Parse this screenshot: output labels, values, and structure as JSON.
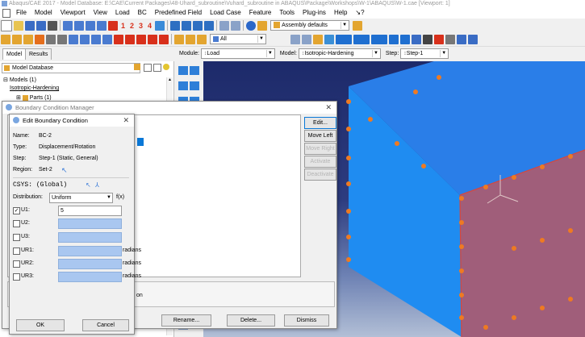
{
  "window": {
    "title": "Abaqus/CAE 2017 - Model Database: E:\\CAE\\Current Packages\\48-Uhard_subroutine\\Vuhard_subroutine in ABAQUS\\Package\\Workshops\\W-1\\ABAQUS\\W-1.cae [Viewport: 1]"
  },
  "menu": [
    "File",
    "Model",
    "Viewport",
    "View",
    "Load",
    "BC",
    "Predefined Field",
    "Load Case",
    "Feature",
    "Tools",
    "Plug-ins",
    "Help",
    "↘?"
  ],
  "toolbar": {
    "nums": [
      "1",
      "2",
      "3",
      "4"
    ],
    "assembly_value": "Assembly defaults",
    "all_value": "All"
  },
  "tabs": {
    "model": "Model",
    "results": "Results"
  },
  "context": {
    "module_label": "Module:",
    "module_value": "Load",
    "model_label": "Model:",
    "model_value": "Isotropic-Hardening",
    "step_label": "Step:",
    "step_value": "Step-1"
  },
  "tree": {
    "header": "Model Database",
    "items": [
      "Models (1)",
      "Isotropic-Hardening",
      "Parts (1)"
    ]
  },
  "bc_manager": {
    "title": "Boundary Condition Manager",
    "buttons": [
      "Edit...",
      "Move Left",
      "Move Right",
      "Activate",
      "Deactivate"
    ],
    "bottom_buttons": [
      "Rename...",
      "Delete...",
      "Dismiss"
    ],
    "partial_text": "on"
  },
  "edit_bc": {
    "title": "Edit Boundary Condition",
    "name_label": "Name:",
    "name_value": "BC-2",
    "type_label": "Type:",
    "type_value": "Displacement/Rotation",
    "step_label": "Step:",
    "step_value": "Step-1 (Static, General)",
    "region_label": "Region:",
    "region_value": "Set-2",
    "csys_label": "CSYS:",
    "csys_value": "(Global)",
    "distribution_label": "Distribution:",
    "distribution_value": "Uniform",
    "fx_label": "f(x)",
    "dofs": [
      {
        "label": "U1:",
        "checked": true,
        "value": "5",
        "unit": ""
      },
      {
        "label": "U2:",
        "checked": false,
        "value": "",
        "unit": ""
      },
      {
        "label": "U3:",
        "checked": false,
        "value": "",
        "unit": ""
      },
      {
        "label": "UR1:",
        "checked": false,
        "value": "",
        "unit": "radians"
      },
      {
        "label": "UR2:",
        "checked": false,
        "value": "",
        "unit": "radians"
      },
      {
        "label": "UR3:",
        "checked": false,
        "value": "",
        "unit": "radians"
      }
    ],
    "ok": "OK",
    "cancel": "Cancel"
  },
  "colors": {
    "cube_face": "#1f8cf1",
    "loaded_face": "#a05e7a",
    "marker": "#ee7a22"
  }
}
